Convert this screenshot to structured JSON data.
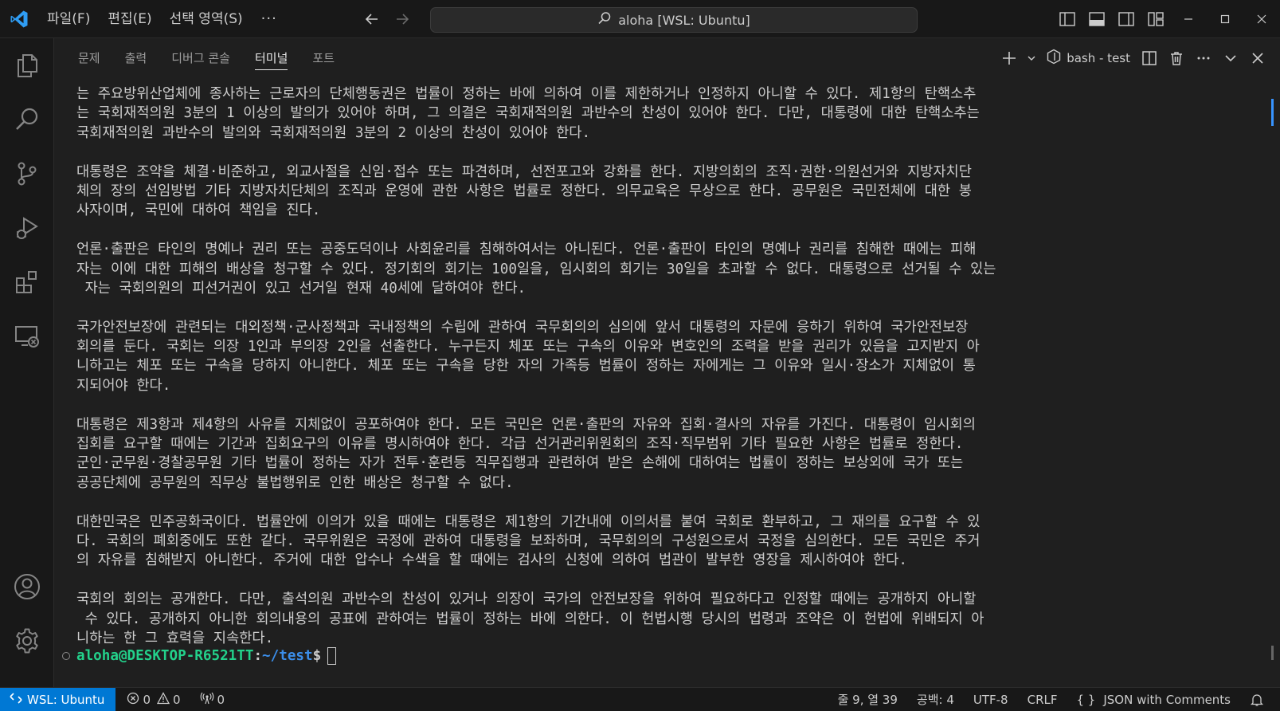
{
  "titlebar": {
    "menu": [
      "파일(F)",
      "편집(E)",
      "선택 영역(S)"
    ],
    "more": "···",
    "command_center": "aloha [WSL: Ubuntu]"
  },
  "panel": {
    "tabs": [
      "문제",
      "출력",
      "디버그 콘솔",
      "터미널",
      "포트"
    ],
    "active_tab": "터미널",
    "terminal_name": "bash - test"
  },
  "terminal": {
    "lines": [
      "는 주요방위산업체에 종사하는 근로자의 단체행동권은 법률이 정하는 바에 의하여 이를 제한하거나 인정하지 아니할 수 있다. 제1항의 탄핵소추",
      "는 국회재적의원 3분의 1 이상의 발의가 있어야 하며, 그 의결은 국회재적의원 과반수의 찬성이 있어야 한다. 다만, 대통령에 대한 탄핵소추는",
      "국회재적의원 과반수의 발의와 국회재적의원 3분의 2 이상의 찬성이 있어야 한다.",
      "",
      "대통령은 조약을 체결·비준하고, 외교사절을 신임·접수 또는 파견하며, 선전포고와 강화를 한다. 지방의회의 조직·권한·의원선거와 지방자치단",
      "체의 장의 선임방법 기타 지방자치단체의 조직과 운영에 관한 사항은 법률로 정한다. 의무교육은 무상으로 한다. 공무원은 국민전체에 대한 봉",
      "사자이며, 국민에 대하여 책임을 진다.",
      "",
      "언론·출판은 타인의 명예나 권리 또는 공중도덕이나 사회윤리를 침해하여서는 아니된다. 언론·출판이 타인의 명예나 권리를 침해한 때에는 피해",
      "자는 이에 대한 피해의 배상을 청구할 수 있다. 정기회의 회기는 100일을, 임시회의 회기는 30일을 초과할 수 없다. 대통령으로 선거될 수 있는",
      " 자는 국회의원의 피선거권이 있고 선거일 현재 40세에 달하여야 한다.",
      "",
      "국가안전보장에 관련되는 대외정책·군사정책과 국내정책의 수립에 관하여 국무회의의 심의에 앞서 대통령의 자문에 응하기 위하여 국가안전보장",
      "회의를 둔다. 국회는 의장 1인과 부의장 2인을 선출한다. 누구든지 체포 또는 구속의 이유와 변호인의 조력을 받을 권리가 있음을 고지받지 아",
      "니하고는 체포 또는 구속을 당하지 아니한다. 체포 또는 구속을 당한 자의 가족등 법률이 정하는 자에게는 그 이유와 일시·장소가 지체없이 통",
      "지되어야 한다.",
      "",
      "대통령은 제3항과 제4항의 사유를 지체없이 공포하여야 한다. 모든 국민은 언론·출판의 자유와 집회·결사의 자유를 가진다. 대통령이 임시회의",
      "집회를 요구할 때에는 기간과 집회요구의 이유를 명시하여야 한다. 각급 선거관리위원회의 조직·직무범위 기타 필요한 사항은 법률로 정한다.",
      "군인·군무원·경찰공무원 기타 법률이 정하는 자가 전투·훈련등 직무집행과 관련하여 받은 손해에 대하여는 법률이 정하는 보상외에 국가 또는",
      "공공단체에 공무원의 직무상 불법행위로 인한 배상은 청구할 수 없다.",
      "",
      "대한민국은 민주공화국이다. 법률안에 이의가 있을 때에는 대통령은 제1항의 기간내에 이의서를 붙여 국회로 환부하고, 그 재의를 요구할 수 있",
      "다. 국회의 폐회중에도 또한 같다. 국무위원은 국정에 관하여 대통령을 보좌하며, 국무회의의 구성원으로서 국정을 심의한다. 모든 국민은 주거",
      "의 자유를 침해받지 아니한다. 주거에 대한 압수나 수색을 할 때에는 검사의 신청에 의하여 법관이 발부한 영장을 제시하여야 한다.",
      "",
      "국회의 회의는 공개한다. 다만, 출석의원 과반수의 찬성이 있거나 의장이 국가의 안전보장을 위하여 필요하다고 인정할 때에는 공개하지 아니할",
      " 수 있다. 공개하지 아니한 회의내용의 공표에 관하여는 법률이 정하는 바에 의한다. 이 헌법시행 당시의 법령과 조약은 이 헌법에 위배되지 아",
      "니하는 한 그 효력을 지속한다."
    ],
    "prompt_user": "aloha@DESKTOP-R6521TT",
    "prompt_sep": ":",
    "prompt_path": "~/test",
    "prompt_dollar": "$"
  },
  "statusbar": {
    "remote": "WSL: Ubuntu",
    "errors": "0",
    "warnings": "0",
    "ports": "0",
    "position": "줄 9, 열 39",
    "spaces": "공백: 4",
    "encoding": "UTF-8",
    "eol": "CRLF",
    "language_glyph": "{ }",
    "language": "JSON with Comments"
  },
  "colors": {
    "accent": "#0078d4",
    "prompt_user": "#23d18b",
    "prompt_path": "#3b8eea"
  }
}
